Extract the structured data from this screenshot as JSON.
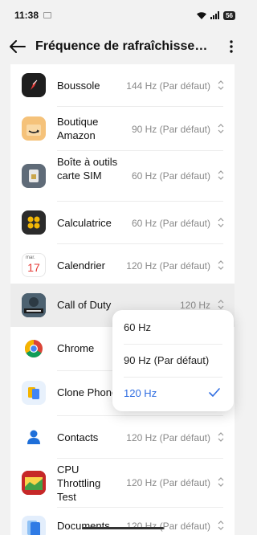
{
  "status_bar": {
    "time": "11:38",
    "battery": "56"
  },
  "header": {
    "title": "Fréquence de rafraîchisseme…"
  },
  "apps": [
    {
      "name": "Boussole",
      "value": "144 Hz  (Par défaut)",
      "icon": "compass-icon"
    },
    {
      "name": "Boutique Amazon",
      "value": "90 Hz  (Par défaut)",
      "icon": "amazon-icon"
    },
    {
      "name": "Boîte à outils carte SIM",
      "value": "60 Hz  (Par défaut)",
      "icon": "sim-toolkit-icon"
    },
    {
      "name": "Calculatrice",
      "value": "60 Hz  (Par défaut)",
      "icon": "calculator-icon"
    },
    {
      "name": "Calendrier",
      "value": "120 Hz  (Par défaut)",
      "icon": "calendar-icon",
      "icon_day": "mar.",
      "icon_date": "17"
    },
    {
      "name": "Call of Duty",
      "value": "120 Hz",
      "icon": "call-of-duty-icon"
    },
    {
      "name": "Chrome",
      "value": "",
      "icon": "chrome-icon"
    },
    {
      "name": "Clone Phone",
      "value": "",
      "icon": "clone-phone-icon"
    },
    {
      "name": "Contacts",
      "value": "120 Hz  (Par défaut)",
      "icon": "contacts-icon"
    },
    {
      "name": "CPU Throttling Test",
      "value": "120 Hz  (Par défaut)",
      "icon": "cpu-throttling-icon"
    },
    {
      "name": "Documents",
      "value": "120 Hz  (Par défaut)",
      "icon": "documents-icon"
    }
  ],
  "popup": {
    "options": [
      {
        "label": "60 Hz",
        "selected": false
      },
      {
        "label": "90 Hz  (Par défaut)",
        "selected": false
      },
      {
        "label": "120 Hz",
        "selected": true
      }
    ]
  },
  "colors": {
    "accent": "#2f6de1",
    "highlight_row": "#ececec"
  }
}
